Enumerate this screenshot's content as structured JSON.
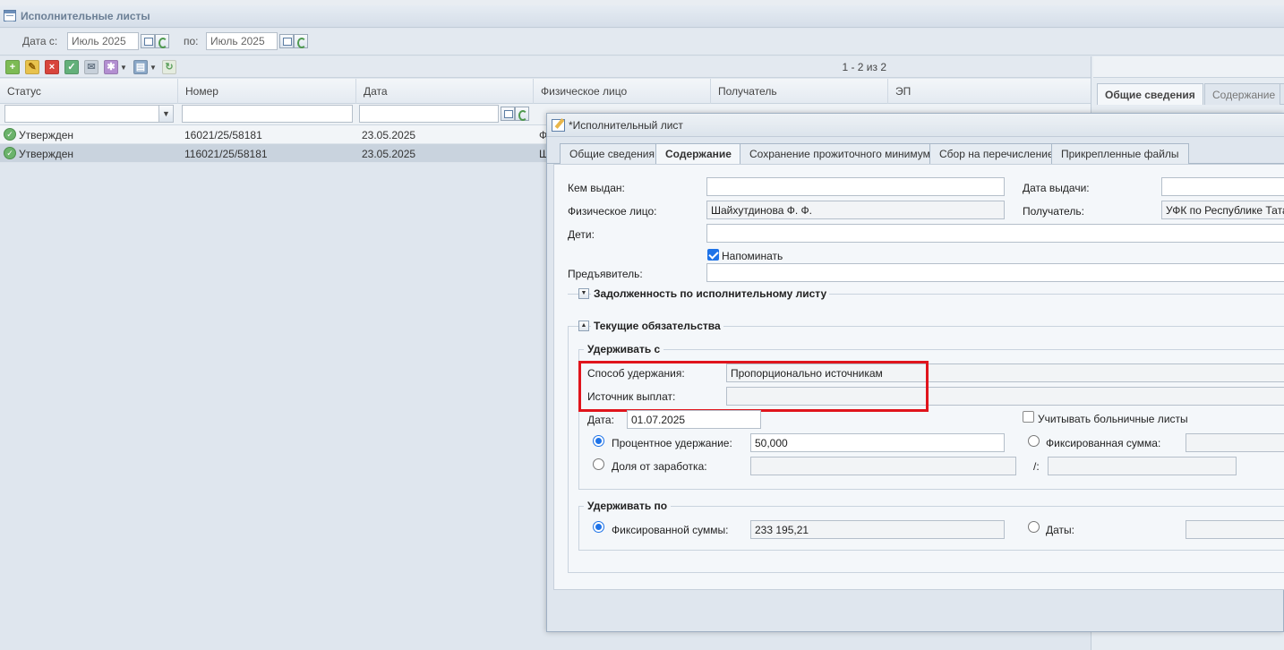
{
  "main": {
    "title": "Исполнительные листы",
    "filter": {
      "date_from_label": "Дата с:",
      "date_from_value": "Июль 2025",
      "date_to_label": "по:",
      "date_to_value": "Июль 2025"
    },
    "toolbar": {
      "icons": [
        "add-icon",
        "edit-icon",
        "delete-icon",
        "approve-icon",
        "mail-icon",
        "star-icon",
        "print-icon",
        "refresh-icon"
      ],
      "pager_text": "1 - 2 из 2"
    },
    "grid": {
      "columns": [
        "Статус",
        "Номер",
        "Дата",
        "Физическое лицо",
        "Получатель",
        "ЭП"
      ],
      "rows": [
        {
          "status": "Утвержден",
          "number": "16021/25/58181",
          "date": "23.05.2025",
          "person": "Ф"
        },
        {
          "status": "Утвержден",
          "number": "116021/25/58181",
          "date": "23.05.2025",
          "person": "Ш"
        }
      ]
    }
  },
  "right_panel": {
    "tabs": [
      "Общие сведения",
      "Содержание"
    ]
  },
  "modal": {
    "title": "*Исполнительный лист",
    "tabs": [
      "Общие сведения",
      "Содержание",
      "Сохранение прожиточного минимума",
      "Сбор на перечисление",
      "Прикрепленные файлы"
    ],
    "active_tab": "Содержание",
    "fields": {
      "issued_by_label": "Кем выдан:",
      "issued_by_value": "",
      "issue_date_label": "Дата выдачи:",
      "issue_date_value": "",
      "person_label": "Физическое лицо:",
      "person_value": "Шайхутдинова Ф. Ф.",
      "recipient_label": "Получатель:",
      "recipient_value": "УФК по Республике Тата",
      "children_label": "Дети:",
      "children_value": "",
      "remind_label": "Напоминать",
      "remind_checked": true,
      "presenter_label": "Предъявитель:",
      "presenter_value": ""
    },
    "sections": {
      "debt_title": "Задолженность по исполнительному листу",
      "obligations_title": "Текущие обязательства"
    },
    "withhold_from": {
      "legend": "Удерживать с",
      "method_label": "Способ удержания:",
      "method_value": "Пропорционально источникам",
      "source_label": "Источник выплат:",
      "source_value": "",
      "date_label": "Дата:",
      "date_value": "01.07.2025",
      "sick_leave_label": "Учитывать больничные листы",
      "sick_leave_checked": false,
      "percent_label": "Процентное удержание:",
      "percent_value": "50,000",
      "percent_selected": true,
      "fixed_label": "Фиксированная сумма:",
      "fixed_value": "",
      "share_label": "Доля от заработка:",
      "share_value": "",
      "share_divider": "/:",
      "share_denominator": ""
    },
    "withhold_until": {
      "legend": "Удерживать по",
      "fixed_sum_label": "Фиксированной суммы:",
      "fixed_sum_value": "233 195,21",
      "fixed_sum_selected": true,
      "dates_label": "Даты:",
      "dates_value": ""
    }
  },
  "colors": {
    "highlight": "#e0141c",
    "accent": "#1e73e8",
    "status_ok": "#6bb36b"
  }
}
